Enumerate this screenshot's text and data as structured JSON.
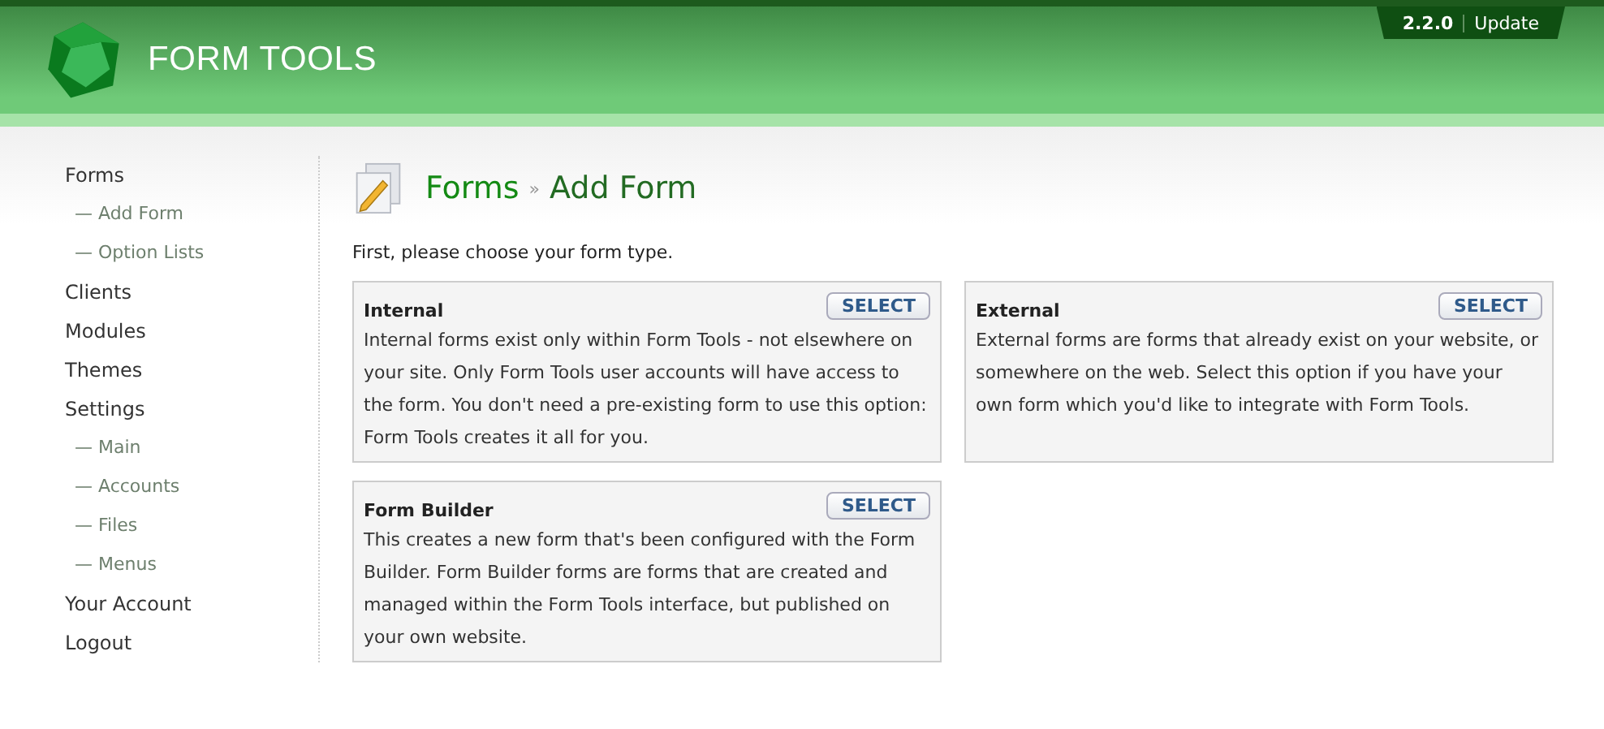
{
  "header": {
    "title": "FORM TOOLS",
    "version": "2.2.0",
    "update_link": "Update"
  },
  "sidebar": {
    "items": [
      {
        "label": "Forms",
        "children": [
          {
            "label": "— Add Form"
          },
          {
            "label": "— Option Lists"
          }
        ]
      },
      {
        "label": "Clients"
      },
      {
        "label": "Modules"
      },
      {
        "label": "Themes"
      },
      {
        "label": "Settings",
        "children": [
          {
            "label": "— Main"
          },
          {
            "label": "— Accounts"
          },
          {
            "label": "— Files"
          },
          {
            "label": "— Menus"
          }
        ]
      },
      {
        "label": "Your Account"
      },
      {
        "label": "Logout"
      }
    ]
  },
  "breadcrumb": {
    "parent": "Forms",
    "separator": "»",
    "current": "Add Form"
  },
  "intro": "First, please choose your form type.",
  "form_types": [
    {
      "title": "Internal",
      "button": "SELECT",
      "description": "Internal forms exist only within Form Tools - not elsewhere on your site. Only Form Tools user accounts will have access to the form. You don't need a pre-existing form to use this option: Form Tools creates it all for you."
    },
    {
      "title": "External",
      "button": "SELECT",
      "description": "External forms are forms that already exist on your website, or somewhere on the web. Select this option if you have your own form which you'd like to integrate with Form Tools."
    },
    {
      "title": "Form Builder",
      "button": "SELECT",
      "description": "This creates a new form that's been configured with the Form Builder. Form Builder forms are forms that are created and managed within the Form Tools interface, but published on your own website."
    }
  ]
}
